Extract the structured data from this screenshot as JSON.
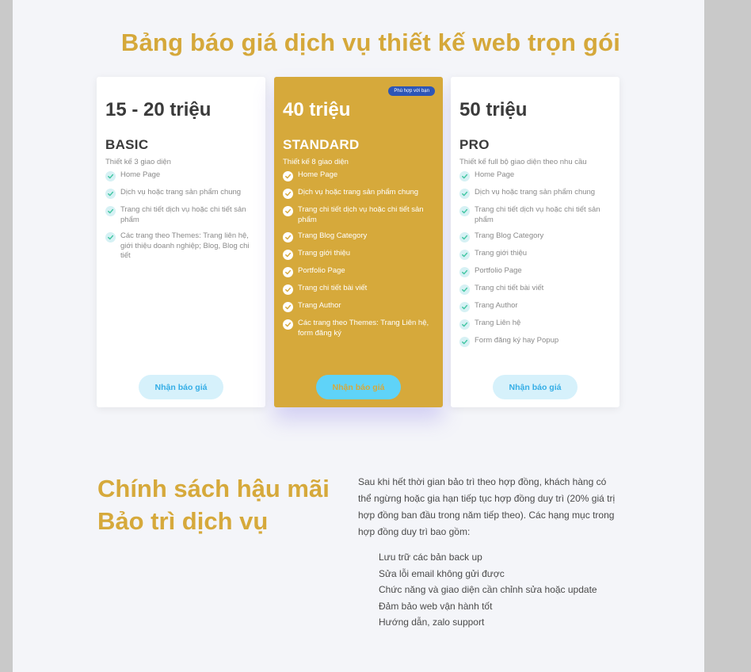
{
  "title": "Bảng báo giá dịch vụ thiết kế web trọn gói",
  "colors": {
    "accent": "#d6a93b",
    "badge": "#2d56b7",
    "cta_text": "#35aee6",
    "check_bg": "#d6f1f4"
  },
  "plans": [
    {
      "price": "15 - 20 triệu",
      "name": "BASIC",
      "description": "Thiết kế 3 giao diện",
      "features": [
        "Home Page",
        "Dịch vụ hoặc trang sản phẩm chung",
        "Trang chi tiết dịch vụ hoặc chi tiết sản phẩm",
        "Các trang theo Themes: Trang liên hệ, giới thiệu doanh nghiệp; Blog, Blog chi tiết"
      ],
      "cta": "Nhận báo giá"
    },
    {
      "price": "40 triệu",
      "name": "STANDARD",
      "badge": "Phù hợp với bạn",
      "description": "Thiết kế 8 giao diện",
      "features": [
        "Home Page",
        "Dịch vụ hoặc trang sản phẩm chung",
        "Trang chi tiết dịch vụ hoặc chi tiết sản phẩm",
        "Trang Blog Category",
        "Trang giới thiệu",
        "Portfolio Page",
        "Trang chi tiết bài viết",
        "Trang Author",
        "Các trang theo Themes: Trang Liên hệ, form đăng ký"
      ],
      "cta": "Nhận báo giá"
    },
    {
      "price": "50 triệu",
      "name": "PRO",
      "description": "Thiết kế full bộ giao diện theo nhu cầu",
      "features": [
        "Home Page",
        "Dịch vụ hoặc trang sản phẩm chung",
        "Trang chi tiết dịch vụ hoặc chi tiết sản phẩm",
        "Trang Blog Category",
        "Trang giới thiệu",
        "Portfolio Page",
        "Trang chi tiết bài viết",
        "Trang Author",
        "Trang Liên hệ",
        "Form đăng ký hay Popup"
      ],
      "cta": "Nhận báo giá"
    }
  ],
  "policy": {
    "title_line1": "Chính sách hậu mãi",
    "title_line2": "Bảo trì dịch vụ",
    "intro": "Sau khi hết thời gian bảo trì theo hợp đồng, khách hàng có thể ngừng hoặc gia hạn tiếp tục hợp đồng duy trì (20% giá trị hợp đồng ban đầu trong năm tiếp theo). Các hạng mục trong hợp đồng duy trì bao gồm:",
    "items": [
      "Lưu trữ các bản back up",
      "Sửa lỗi email không gửi được",
      "Chức năng và giao diện cần chỉnh sửa hoặc update",
      "Đảm bảo web vận hành tốt",
      "Hướng dẫn, zalo support"
    ]
  }
}
